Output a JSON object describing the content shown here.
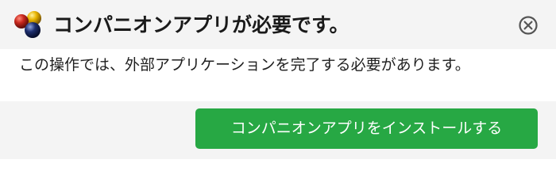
{
  "dialog": {
    "title": "コンパニオンアプリが必要です。",
    "app_icon": "three-spheres-logo-icon",
    "close_icon": "close-circle-icon",
    "message": "この操作では、外部アプリケーションを完了する必要があります。",
    "install_button_label": "コンパニオンアプリをインストールする"
  },
  "colors": {
    "header_background": "#f4f4f4",
    "body_background": "#ffffff",
    "button_background": "#27a844",
    "button_text": "#ffffff",
    "title_text": "#1a1a1a",
    "sphere_red": "#c8281e",
    "sphere_yellow": "#e8b400",
    "sphere_navy": "#1e2f6e"
  }
}
